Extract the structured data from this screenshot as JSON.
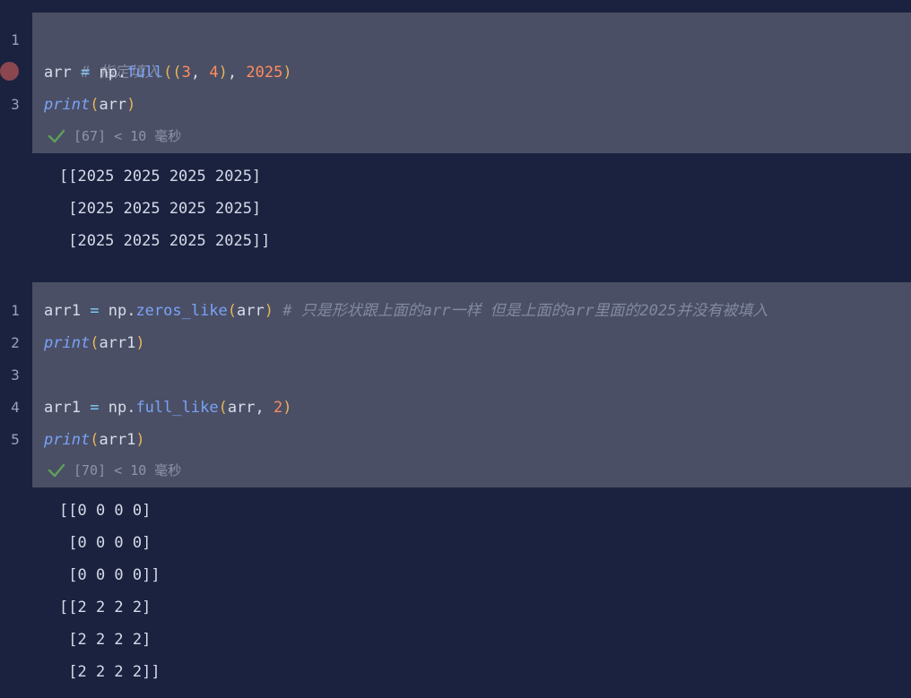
{
  "cell1": {
    "line_numbers": [
      "1",
      "3"
    ],
    "code": {
      "l1_comment": "# 指定填入",
      "l2": {
        "var": "arr",
        "eq": "=",
        "mod": "np",
        "dot": ".",
        "fn": "full",
        "p1": "((",
        "n1": "3",
        "comma1": ", ",
        "n2": "4",
        "p2": ")",
        "comma2": ", ",
        "n3": "2025",
        "p3": ")"
      },
      "l3": {
        "fn": "print",
        "p1": "(",
        "arg": "arr",
        "p2": ")"
      }
    },
    "status": "[67] < 10 毫秒",
    "output": [
      "[[2025 2025 2025 2025]",
      " [2025 2025 2025 2025]",
      " [2025 2025 2025 2025]]"
    ]
  },
  "cell2": {
    "line_numbers": [
      "1",
      "2",
      "3",
      "4",
      "5"
    ],
    "code": {
      "l1": {
        "var": "arr1",
        "eq": "=",
        "mod": "np",
        "dot": ".",
        "fn": "zeros_like",
        "p1": "(",
        "arg": "arr",
        "p2": ")",
        "comment": "# 只是形状跟上面的arr一样 但是上面的arr里面的2025并没有被填入"
      },
      "l2": {
        "fn": "print",
        "p1": "(",
        "arg": "arr1",
        "p2": ")"
      },
      "l4": {
        "var": "arr1",
        "eq": "=",
        "mod": "np",
        "dot": ".",
        "fn": "full_like",
        "p1": "(",
        "arg": "arr",
        "comma": ", ",
        "n": "2",
        "p2": ")"
      },
      "l5": {
        "fn": "print",
        "p1": "(",
        "arg": "arr1",
        "p2": ")"
      }
    },
    "status": "[70] < 10 毫秒",
    "output": [
      "[[0 0 0 0]",
      " [0 0 0 0]",
      " [0 0 0 0]]",
      "[[2 2 2 2]",
      " [2 2 2 2]",
      " [2 2 2 2]]"
    ]
  },
  "colors": {
    "background": "#1b2240",
    "cell_background": "#4a4f65",
    "breakpoint": "#8b4650",
    "check": "#5fa05a"
  },
  "icons": {
    "breakpoint": "breakpoint-dot",
    "status": "check-icon"
  }
}
